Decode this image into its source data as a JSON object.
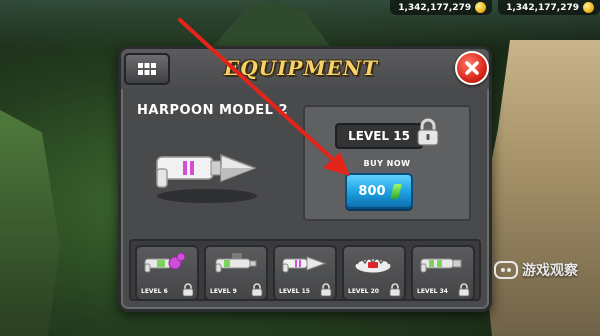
{
  "hud": {
    "currency_1": "1,342,177,279",
    "currency_2": "1,342,177,279"
  },
  "panel": {
    "title": "EQUIPMENT",
    "item_name": "HARPOON MODEL 2",
    "required_level": "LEVEL 15",
    "buy_label": "BUY NOW",
    "price": "800"
  },
  "weapons": [
    {
      "level": "LEVEL 6",
      "color": "#d04fd8"
    },
    {
      "level": "LEVEL 9",
      "color": "#7ad45a"
    },
    {
      "level": "LEVEL 15",
      "color": "#e8e8e8"
    },
    {
      "level": "LEVEL 20",
      "color": "#d9262a"
    },
    {
      "level": "LEVEL 34",
      "color": "#7ad45a"
    }
  ],
  "watermark": {
    "text": "游戏观察"
  },
  "colors": {
    "title_gold": "#f6d36a",
    "buy_button": "#1c9fe0",
    "close_button": "#d9291a",
    "arrow": "#e3241b"
  }
}
